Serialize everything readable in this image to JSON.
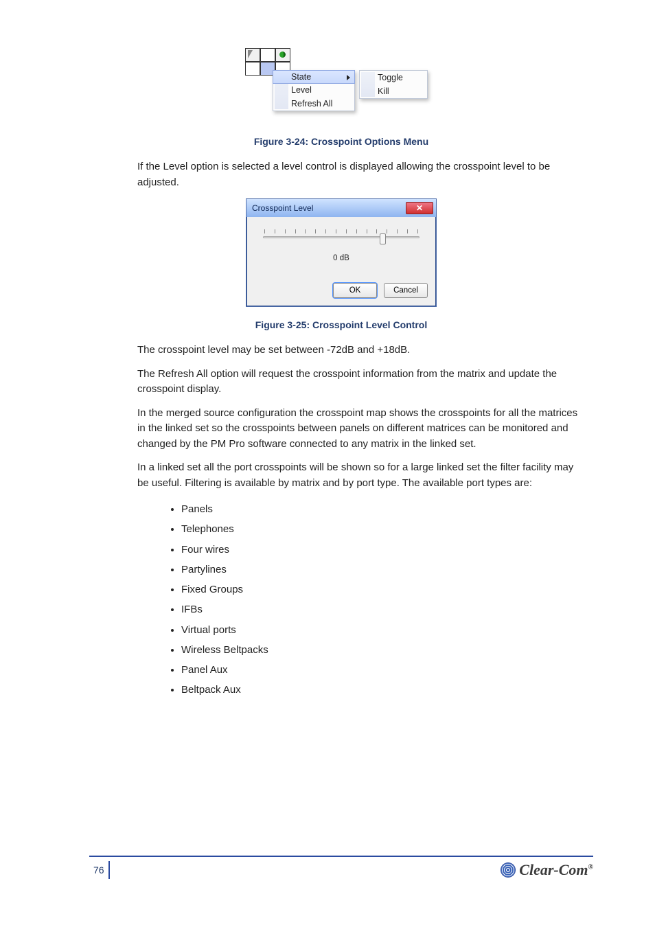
{
  "body": {
    "p1": "If the Level option is selected a level control is displayed allowing the crosspoint level to be adjusted.",
    "p2": "The crosspoint level may be set between -72dB and +18dB.",
    "p3": "The Refresh All option will request the crosspoint information from the matrix and update the crosspoint display.",
    "p4": "In the merged source configuration the crosspoint map shows the crosspoints for all the matrices in the linked set so the crosspoints between panels on different matrices can be monitored and changed by the PM Pro software connected to any matrix in the linked set.",
    "p5": "In a linked set all the port crosspoints will be shown so for a large linked set the filter facility may be useful. Filtering is available by matrix and by port type. The available port types are:"
  },
  "fig1": {
    "menu": {
      "state": "State",
      "level": "Level",
      "refresh": "Refresh All",
      "sub_toggle": "Toggle",
      "sub_kill": "Kill"
    },
    "caption": "Figure 3-24: Crosspoint Options Menu"
  },
  "fig2": {
    "title": "Crosspoint Level",
    "readout": "0 dB",
    "ok": "OK",
    "cancel": "Cancel",
    "slider_percent": 75,
    "caption": "Figure 3-25: Crosspoint Level Control"
  },
  "filters": [
    "Panels",
    "Telephones",
    "Four wires",
    "Partylines",
    "Fixed Groups",
    "IFBs",
    "Virtual ports",
    "Wireless Beltpacks",
    "Panel Aux",
    "Beltpack Aux"
  ],
  "footer": {
    "page": "76",
    "brand": "Clear-Com"
  }
}
